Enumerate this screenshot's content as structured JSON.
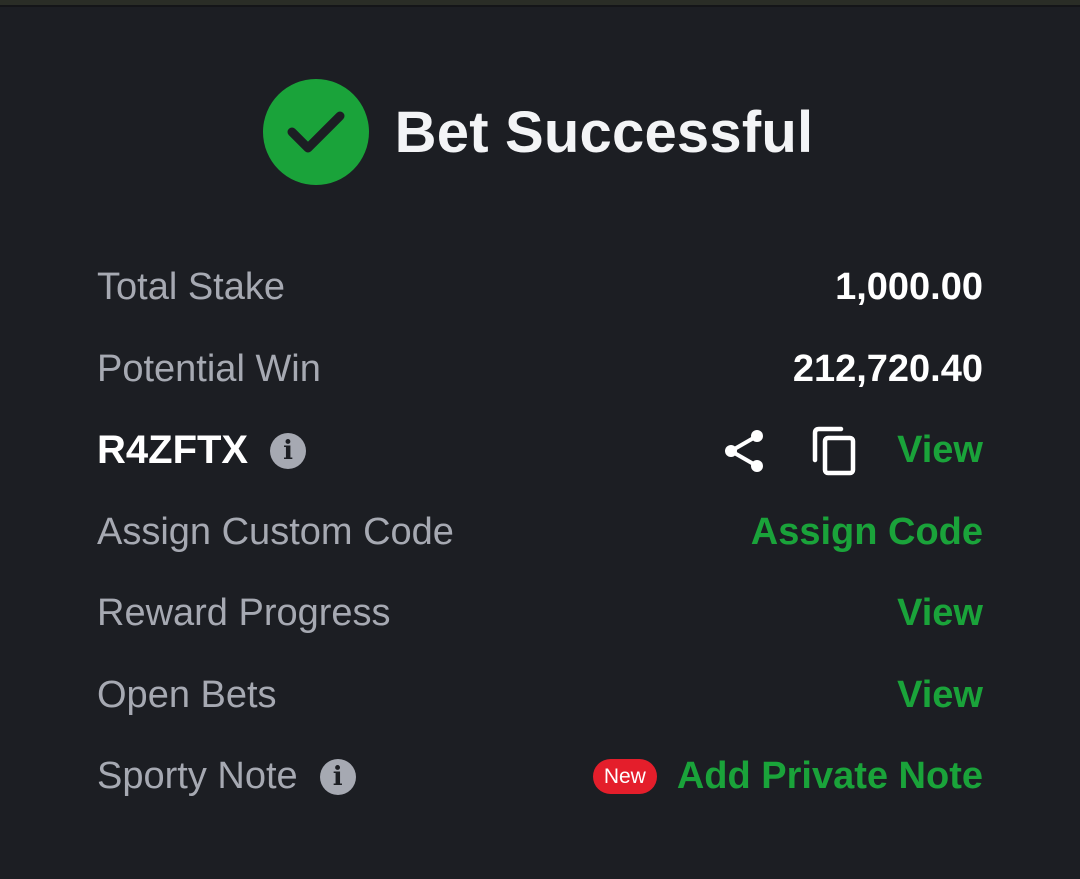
{
  "header": {
    "title": "Bet Successful",
    "icon": "check-circle-icon",
    "accent_color": "#1aa33a"
  },
  "details": {
    "total_stake": {
      "label": "Total Stake",
      "value": "1,000.00"
    },
    "potential_win": {
      "label": "Potential Win",
      "value": "212,720.40"
    },
    "booking": {
      "code": "R4ZFTX",
      "info_icon": "info-icon",
      "share_icon": "share-icon",
      "copy_icon": "copy-icon",
      "action": "View"
    },
    "custom_code": {
      "label": "Assign Custom Code",
      "action": "Assign Code"
    },
    "reward_progress": {
      "label": "Reward Progress",
      "action": "View"
    },
    "open_bets": {
      "label": "Open Bets",
      "action": "View"
    },
    "sporty_note": {
      "label": "Sporty Note",
      "info_icon": "info-icon",
      "badge": "New",
      "action": "Add Private Note"
    }
  },
  "colors": {
    "background": "#1c1e23",
    "label": "#a6a9b2",
    "link": "#1aa33a",
    "badge": "#e41e2b"
  }
}
